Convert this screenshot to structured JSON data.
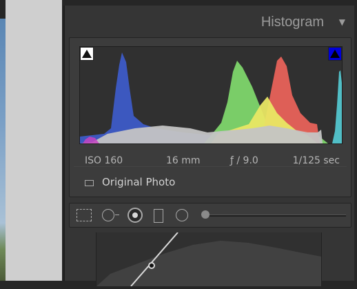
{
  "panel": {
    "title": "Histogram",
    "collapse_glyph": "▼"
  },
  "histogram": {
    "shadow_clipping_icon": "shadow-clipping-triangle-white",
    "highlight_clipping_icon": "highlight-clipping-triangle-blue",
    "colors": {
      "red": "#e8625a",
      "green": "#7ed66b",
      "blue": "#3d5bc7",
      "yellow": "#e9e764",
      "cyan": "#53c6cf",
      "magenta": "#c744c1",
      "luminance": "#c4c4c4"
    }
  },
  "exif": {
    "iso": "ISO 160",
    "focal_length": "16 mm",
    "aperture": "ƒ / 9.0",
    "shutter": "1/125 sec"
  },
  "original_photo": {
    "label": "Original Photo"
  },
  "tools": [
    {
      "name": "crop-overlay-icon"
    },
    {
      "name": "spot-removal-icon"
    },
    {
      "name": "red-eye-icon"
    },
    {
      "name": "graduated-filter-icon"
    },
    {
      "name": "radial-filter-icon"
    },
    {
      "name": "adjustment-brush-slider"
    }
  ]
}
